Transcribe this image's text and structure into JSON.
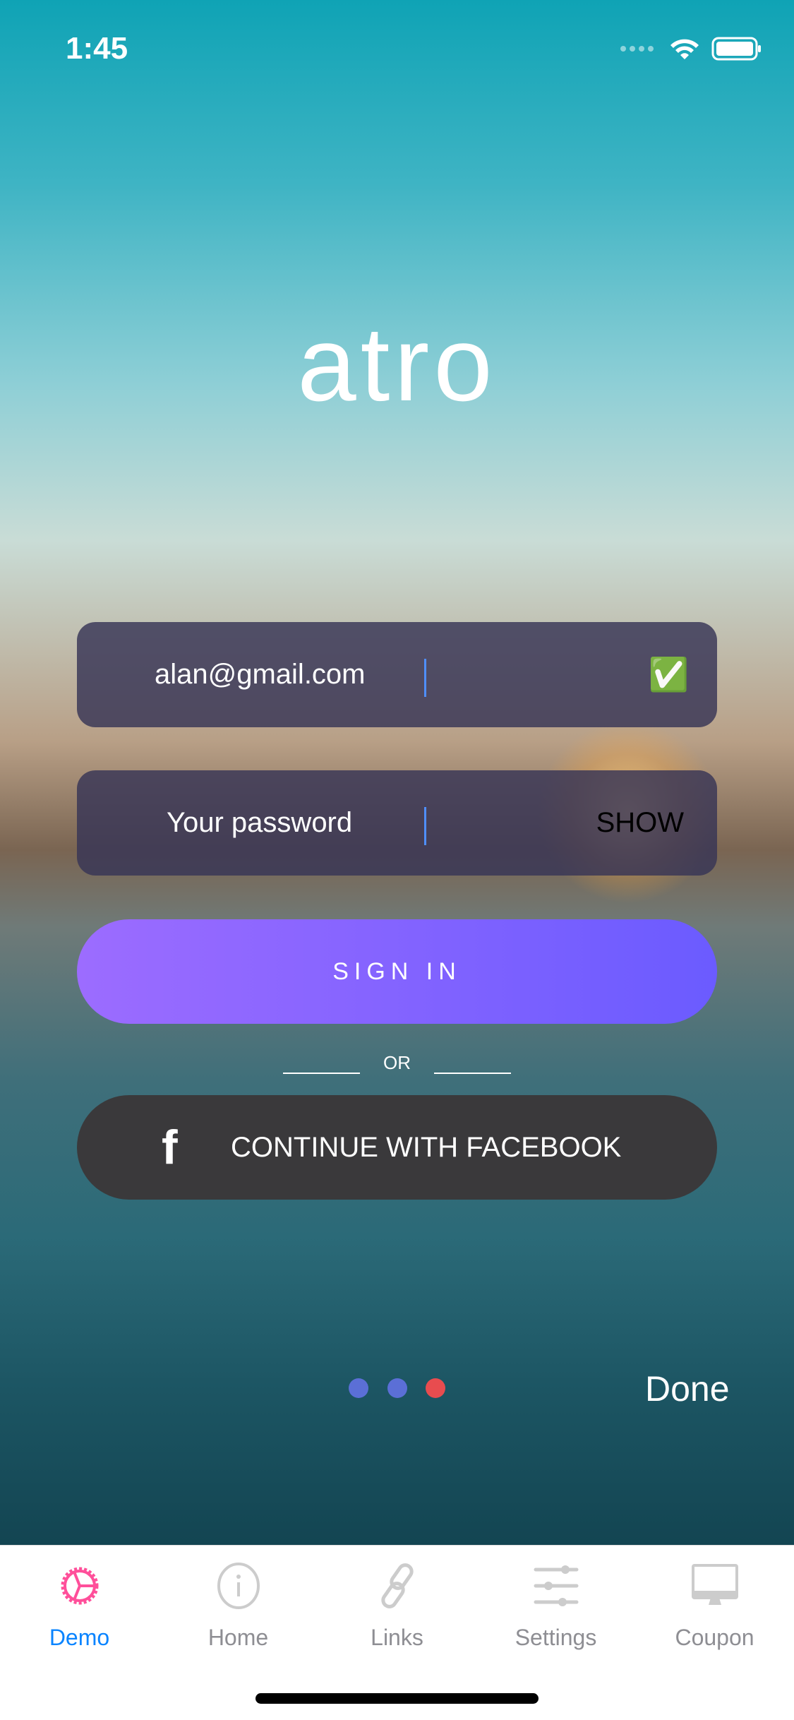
{
  "status_bar": {
    "time": "1:45"
  },
  "logo": {
    "text": "atro"
  },
  "form": {
    "email": {
      "value": "alan@gmail.com",
      "valid_icon": "check-mark-button-emoji",
      "valid_glyph": "✅"
    },
    "password": {
      "placeholder": "Your password",
      "show_label": "SHOW"
    },
    "signin_label": "SIGN IN",
    "or_label": "OR",
    "facebook_label": "CONTINUE WITH FACEBOOK"
  },
  "pager": {
    "count": 3,
    "current": 3,
    "colors": {
      "inactive": "#5b6fd6",
      "active": "#e84c4f"
    }
  },
  "done_label": "Done",
  "tabbar": {
    "active_color": "#0a84ff",
    "items": [
      {
        "label": "Demo",
        "icon": "gear-pie-icon"
      },
      {
        "label": "Home",
        "icon": "info-icon"
      },
      {
        "label": "Links",
        "icon": "link-icon"
      },
      {
        "label": "Settings",
        "icon": "sliders-icon"
      },
      {
        "label": "Coupon",
        "icon": "monitor-icon"
      }
    ]
  }
}
